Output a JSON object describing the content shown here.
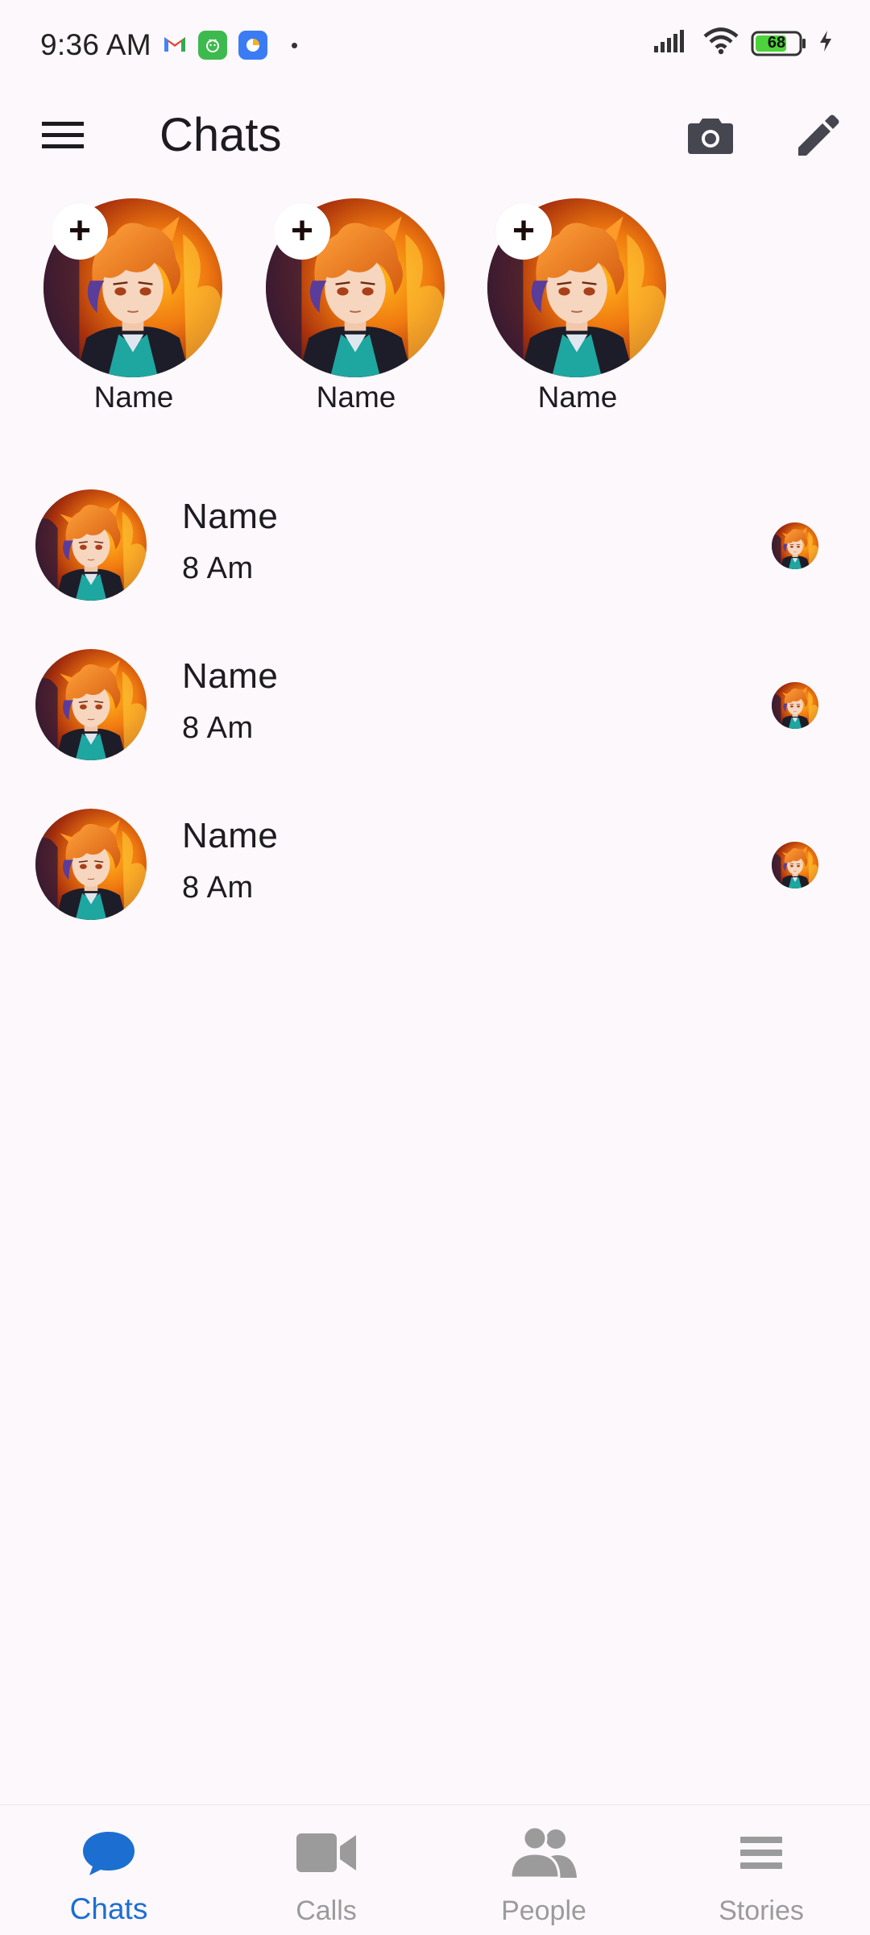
{
  "status_bar": {
    "time": "9:36 AM",
    "battery": "68",
    "icons": [
      "gmail-icon",
      "android-app-icon",
      "blue-app-icon",
      "signal-icon",
      "wifi-icon",
      "battery-icon",
      "charging-icon"
    ]
  },
  "app_bar": {
    "title": "Chats",
    "icons": [
      "menu-icon",
      "camera-icon",
      "edit-pencil-icon"
    ]
  },
  "stories": [
    {
      "name": "Name",
      "add": "+"
    },
    {
      "name": "Name",
      "add": "+"
    },
    {
      "name": "Name",
      "add": "+"
    }
  ],
  "chats": [
    {
      "name": "Name",
      "time": "8 Am"
    },
    {
      "name": "Name",
      "time": "8 Am"
    },
    {
      "name": "Name",
      "time": "8 Am"
    }
  ],
  "bottom_nav": {
    "active": "Chats",
    "items": [
      {
        "label": "Chats",
        "icon": "chat-bubble-icon"
      },
      {
        "label": "Calls",
        "icon": "video-camera-icon"
      },
      {
        "label": "People",
        "icon": "people-icon"
      },
      {
        "label": "Stories",
        "icon": "stories-icon"
      }
    ]
  },
  "colors": {
    "background": "#fdf8fc",
    "accent": "#1c6fd1",
    "inactive": "#9b9b9b",
    "text": "#1d1b20"
  }
}
